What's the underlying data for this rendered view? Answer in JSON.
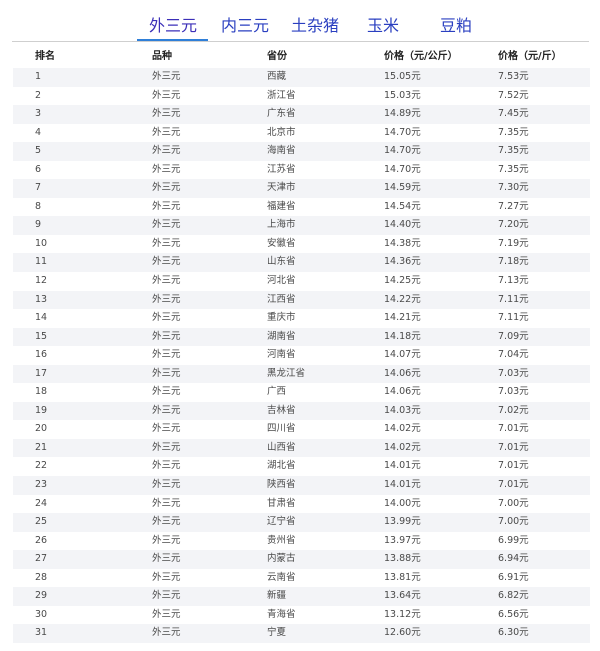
{
  "tabs": [
    {
      "label": "外三元"
    },
    {
      "label": "内三元"
    },
    {
      "label": "土杂猪"
    },
    {
      "label": "玉米"
    },
    {
      "label": "豆粕"
    }
  ],
  "table": {
    "headers": [
      "排名",
      "品种",
      "省份",
      "价格（元/公斤）",
      "价格（元/斤）"
    ],
    "rows": [
      [
        "1",
        "外三元",
        "西藏",
        "15.05元",
        "7.53元"
      ],
      [
        "2",
        "外三元",
        "浙江省",
        "15.03元",
        "7.52元"
      ],
      [
        "3",
        "外三元",
        "广东省",
        "14.89元",
        "7.45元"
      ],
      [
        "4",
        "外三元",
        "北京市",
        "14.70元",
        "7.35元"
      ],
      [
        "5",
        "外三元",
        "海南省",
        "14.70元",
        "7.35元"
      ],
      [
        "6",
        "外三元",
        "江苏省",
        "14.70元",
        "7.35元"
      ],
      [
        "7",
        "外三元",
        "天津市",
        "14.59元",
        "7.30元"
      ],
      [
        "8",
        "外三元",
        "福建省",
        "14.54元",
        "7.27元"
      ],
      [
        "9",
        "外三元",
        "上海市",
        "14.40元",
        "7.20元"
      ],
      [
        "10",
        "外三元",
        "安徽省",
        "14.38元",
        "7.19元"
      ],
      [
        "11",
        "外三元",
        "山东省",
        "14.36元",
        "7.18元"
      ],
      [
        "12",
        "外三元",
        "河北省",
        "14.25元",
        "7.13元"
      ],
      [
        "13",
        "外三元",
        "江西省",
        "14.22元",
        "7.11元"
      ],
      [
        "14",
        "外三元",
        "重庆市",
        "14.21元",
        "7.11元"
      ],
      [
        "15",
        "外三元",
        "湖南省",
        "14.18元",
        "7.09元"
      ],
      [
        "16",
        "外三元",
        "河南省",
        "14.07元",
        "7.04元"
      ],
      [
        "17",
        "外三元",
        "黑龙江省",
        "14.06元",
        "7.03元"
      ],
      [
        "18",
        "外三元",
        "广西",
        "14.06元",
        "7.03元"
      ],
      [
        "19",
        "外三元",
        "吉林省",
        "14.03元",
        "7.02元"
      ],
      [
        "20",
        "外三元",
        "四川省",
        "14.02元",
        "7.01元"
      ],
      [
        "21",
        "外三元",
        "山西省",
        "14.02元",
        "7.01元"
      ],
      [
        "22",
        "外三元",
        "湖北省",
        "14.01元",
        "7.01元"
      ],
      [
        "23",
        "外三元",
        "陕西省",
        "14.01元",
        "7.01元"
      ],
      [
        "24",
        "外三元",
        "甘肃省",
        "14.00元",
        "7.00元"
      ],
      [
        "25",
        "外三元",
        "辽宁省",
        "13.99元",
        "7.00元"
      ],
      [
        "26",
        "外三元",
        "贵州省",
        "13.97元",
        "6.99元"
      ],
      [
        "27",
        "外三元",
        "内蒙古",
        "13.88元",
        "6.94元"
      ],
      [
        "28",
        "外三元",
        "云南省",
        "13.81元",
        "6.91元"
      ],
      [
        "29",
        "外三元",
        "新疆",
        "13.64元",
        "6.82元"
      ],
      [
        "30",
        "外三元",
        "青海省",
        "13.12元",
        "6.56元"
      ],
      [
        "31",
        "外三元",
        "宁夏",
        "12.60元",
        "6.30元"
      ]
    ]
  }
}
